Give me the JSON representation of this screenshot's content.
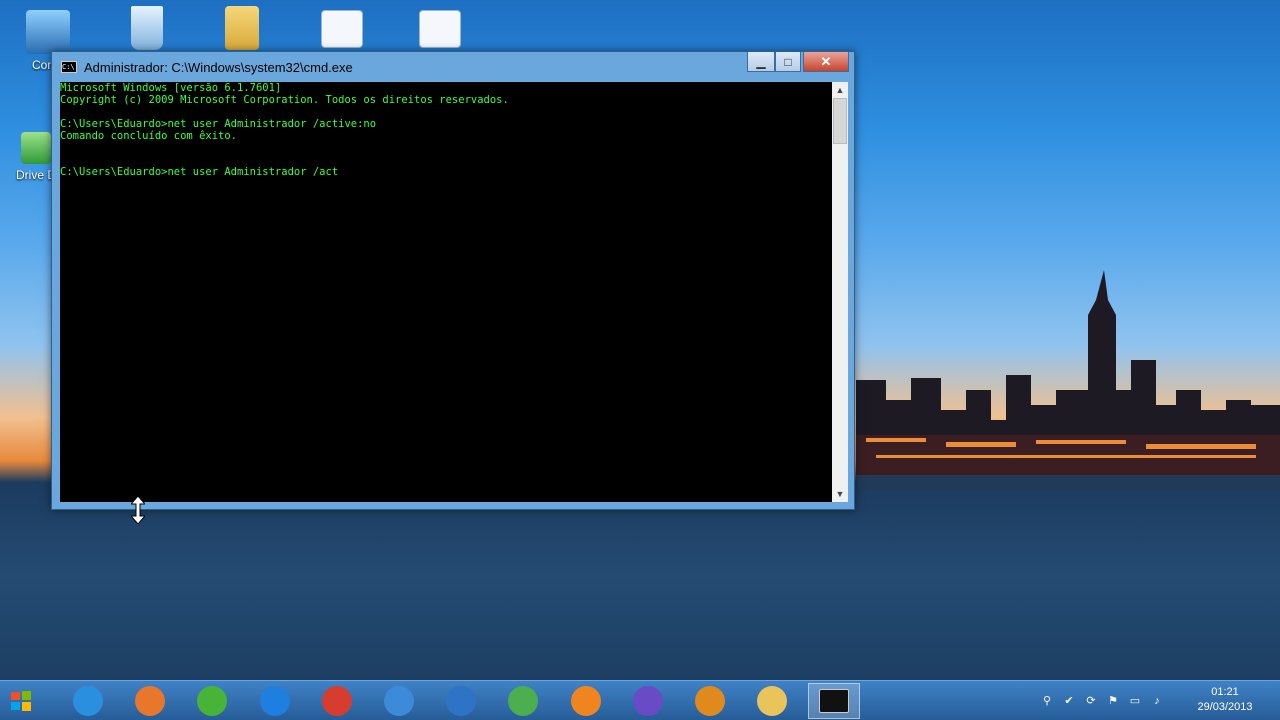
{
  "desktop": {
    "icons": [
      {
        "label": "Comp",
        "icon": "computer-icon"
      },
      {
        "label": "",
        "icon": "recycle-bin-icon"
      },
      {
        "label": "",
        "icon": "user-folder-icon"
      },
      {
        "label": "",
        "icon": "settings-shortcut-icon"
      },
      {
        "label": "",
        "icon": "settings-shortcut-icon"
      },
      {
        "label": "Drive D",
        "icon": "drive-icon"
      }
    ]
  },
  "window": {
    "title": "Administrador: C:\\Windows\\system32\\cmd.exe",
    "title_icon_text": "C:\\",
    "buttons": {
      "minimize": "▁",
      "maximize": "□",
      "close": "✕"
    },
    "console_lines": [
      "Microsoft Windows [versão 6.1.7601]",
      "Copyright (c) 2009 Microsoft Corporation. Todos os direitos reservados.",
      "",
      "C:\\Users\\Eduardo>net user Administrador /active:no",
      "Comando concluído com êxito.",
      "",
      "",
      "C:\\Users\\Eduardo>net user Administrador /act"
    ],
    "text_color": "#3cff3c",
    "background_color": "#000000"
  },
  "taskbar": {
    "apps": [
      {
        "name": "internet-explorer",
        "color": "#2b8fe0"
      },
      {
        "name": "firefox",
        "color": "#e8762b"
      },
      {
        "name": "utorrent",
        "color": "#48b437"
      },
      {
        "name": "thunder-app",
        "color": "#1e7fe0"
      },
      {
        "name": "ccleaner",
        "color": "#d63d2e"
      },
      {
        "name": "flask-app",
        "color": "#3c8bd8"
      },
      {
        "name": "satellite-app",
        "color": "#2f73c7"
      },
      {
        "name": "cube-app",
        "color": "#4cae4f"
      },
      {
        "name": "vlc",
        "color": "#f0851f"
      },
      {
        "name": "building-app",
        "color": "#6a4bc6"
      },
      {
        "name": "pdf-app",
        "color": "#e08a1e"
      },
      {
        "name": "file-explorer",
        "color": "#e8c45a"
      },
      {
        "name": "command-prompt",
        "color": "#111111"
      }
    ],
    "clock": {
      "time": "01:21",
      "date": "29/03/2013"
    }
  }
}
